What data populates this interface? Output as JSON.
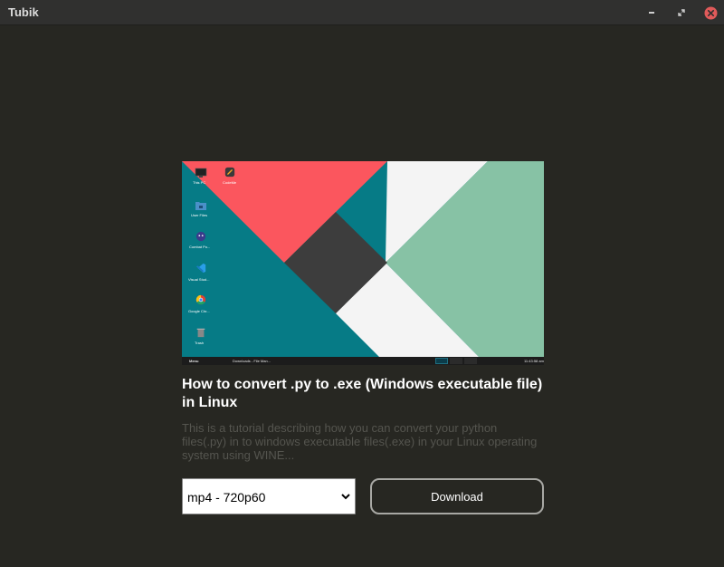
{
  "window": {
    "title": "Tubik",
    "close_color": "#e05a5a"
  },
  "video": {
    "title": "How to convert .py to .exe (Windows executable file) in Linux",
    "description": "This is a tutorial describing how you can convert your python files(.py) in to windows executable files(.exe) in your Linux operating system using WINE...",
    "thumbnail": {
      "desktop_icons": [
        {
          "label": "This PC",
          "icon": "monitor-icon"
        },
        {
          "label": "CodeMe",
          "icon": "app-icon"
        },
        {
          "label": "User Files",
          "icon": "folder-icon"
        },
        {
          "label": "Combat Po...",
          "icon": "game-icon"
        },
        {
          "label": "Visual Stud...",
          "icon": "vscode-icon"
        },
        {
          "label": "Google Chr...",
          "icon": "chrome-icon"
        },
        {
          "label": "Trash",
          "icon": "trash-icon"
        }
      ],
      "taskbar": {
        "menu_label": "Menu",
        "window_label": "Downloads - File Man...",
        "clock": "11:43:58 am"
      },
      "colors": {
        "teal": "#067b86",
        "coral": "#fb565e",
        "white": "#f4f4f4",
        "mint": "#87c2a5",
        "dark": "#3d3d3d"
      }
    }
  },
  "controls": {
    "format_selected": "mp4 - 720p60",
    "download_label": "Download"
  }
}
